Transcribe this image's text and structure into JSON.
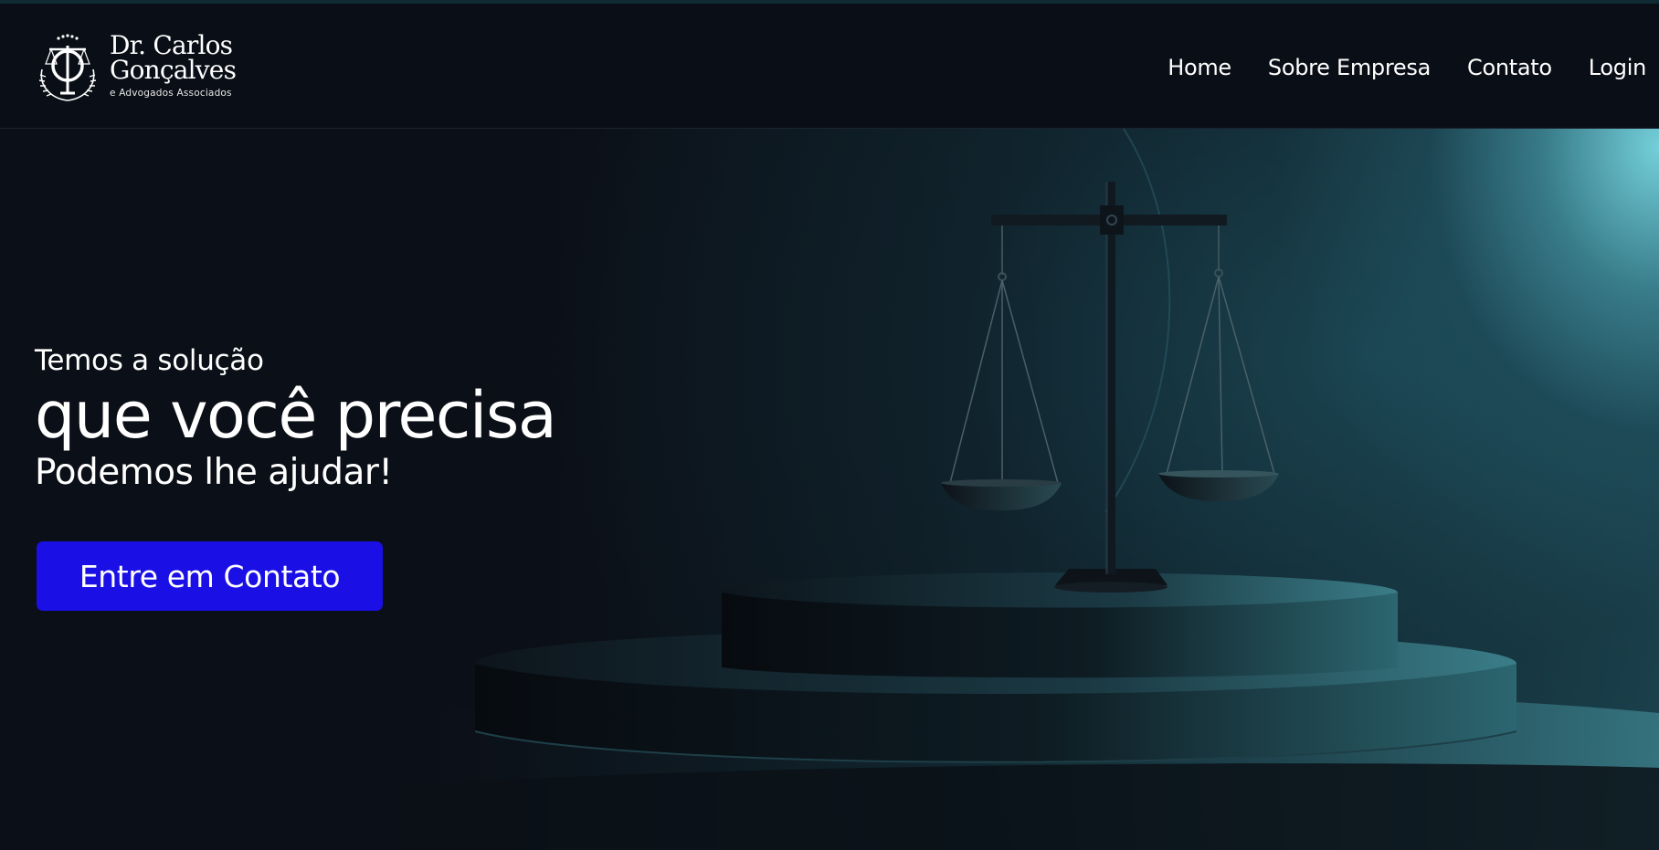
{
  "brand": {
    "name_line1": "Dr. Carlos",
    "name_line2": "Gonçalves",
    "tagline": "e Advogados Associados",
    "logo_monogram": "CG",
    "logo_icon": "scales-of-justice-icon"
  },
  "nav": {
    "items": [
      {
        "label": "Home"
      },
      {
        "label": "Sobre Empresa"
      },
      {
        "label": "Contato"
      },
      {
        "label": "Login"
      }
    ]
  },
  "hero": {
    "eyebrow": "Temos a solução",
    "headline": "que você precisa",
    "subhead": "Podemos lhe ajudar!",
    "cta_label": "Entre em Contato",
    "image": "scales-of-justice-on-pedestal"
  },
  "colors": {
    "background": "#0b0f17",
    "accent_button": "#1a10e6",
    "highlight": "#78d7e1"
  }
}
